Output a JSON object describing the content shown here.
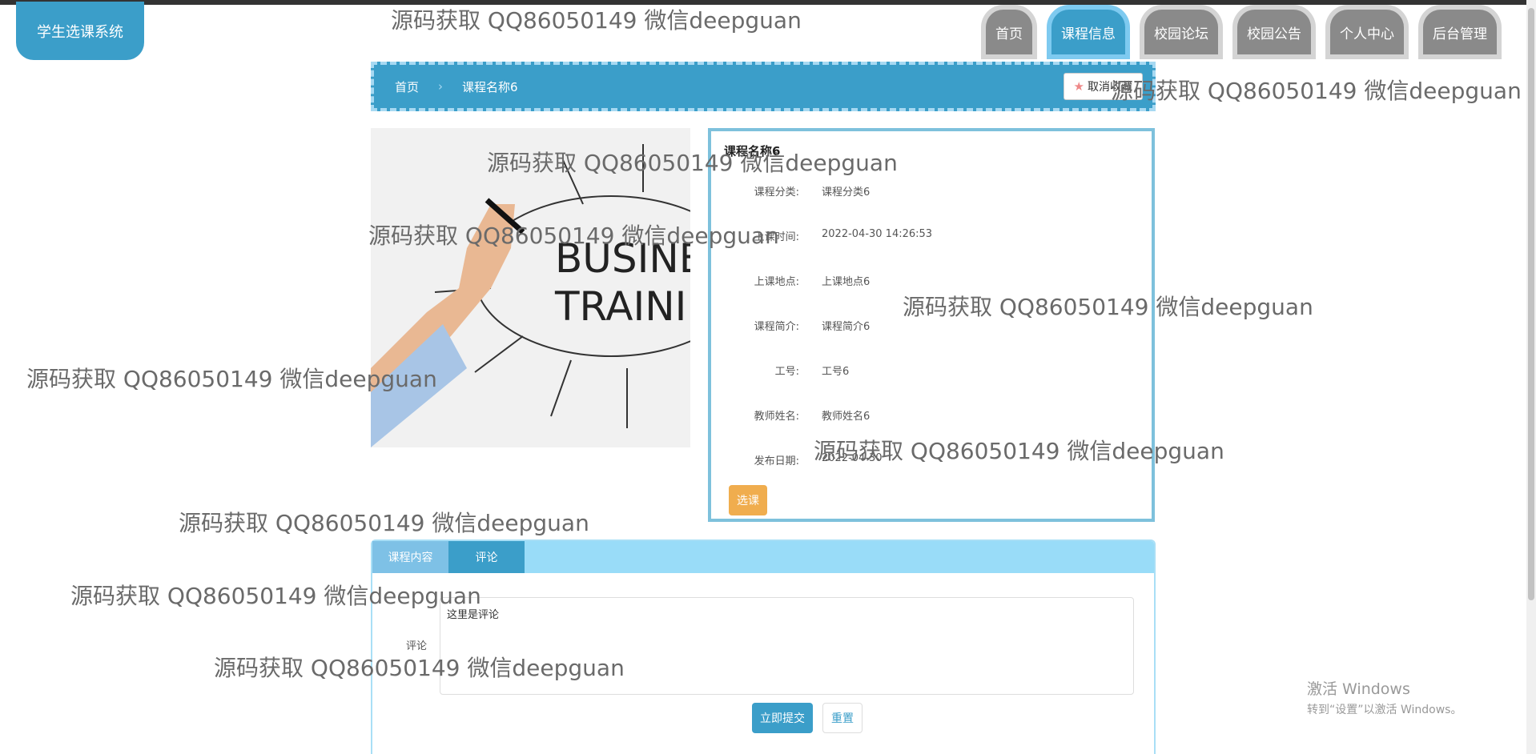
{
  "app": {
    "logo_text": "学生选课系统"
  },
  "nav": {
    "items": [
      {
        "label": "首页"
      },
      {
        "label": "课程信息"
      },
      {
        "label": "校园论坛"
      },
      {
        "label": "校园公告"
      },
      {
        "label": "个人中心"
      },
      {
        "label": "后台管理"
      }
    ]
  },
  "breadcrumb": {
    "home": "首页",
    "separator": "›",
    "current": "课程名称6",
    "favorite_button": "取消收藏"
  },
  "course": {
    "title": "课程名称6",
    "fields": [
      {
        "label": "课程分类:",
        "value": "课程分类6"
      },
      {
        "label": "上课时间:",
        "value": "2022-04-30 14:26:53"
      },
      {
        "label": "上课地点:",
        "value": "上课地点6"
      },
      {
        "label": "课程简介:",
        "value": "课程简介6"
      },
      {
        "label": "工号:",
        "value": "工号6"
      },
      {
        "label": "教师姓名:",
        "value": "教师姓名6"
      },
      {
        "label": "发布日期:",
        "value": "2022-04-30"
      }
    ],
    "select_button": "选课",
    "image_text": [
      "BUSINES",
      "TRAININ"
    ]
  },
  "tabs": {
    "items": [
      {
        "label": "课程内容"
      },
      {
        "label": "评论"
      }
    ],
    "active_index": 1
  },
  "comment": {
    "label": "评论",
    "value": "这里是评论",
    "submit_button": "立即提交",
    "reset_button": "重置"
  },
  "watermark": "源码获取 QQ86050149 微信deepguan",
  "windows_activation": {
    "line1": "激活 Windows",
    "line2": "转到“设置”以激活 Windows。"
  }
}
